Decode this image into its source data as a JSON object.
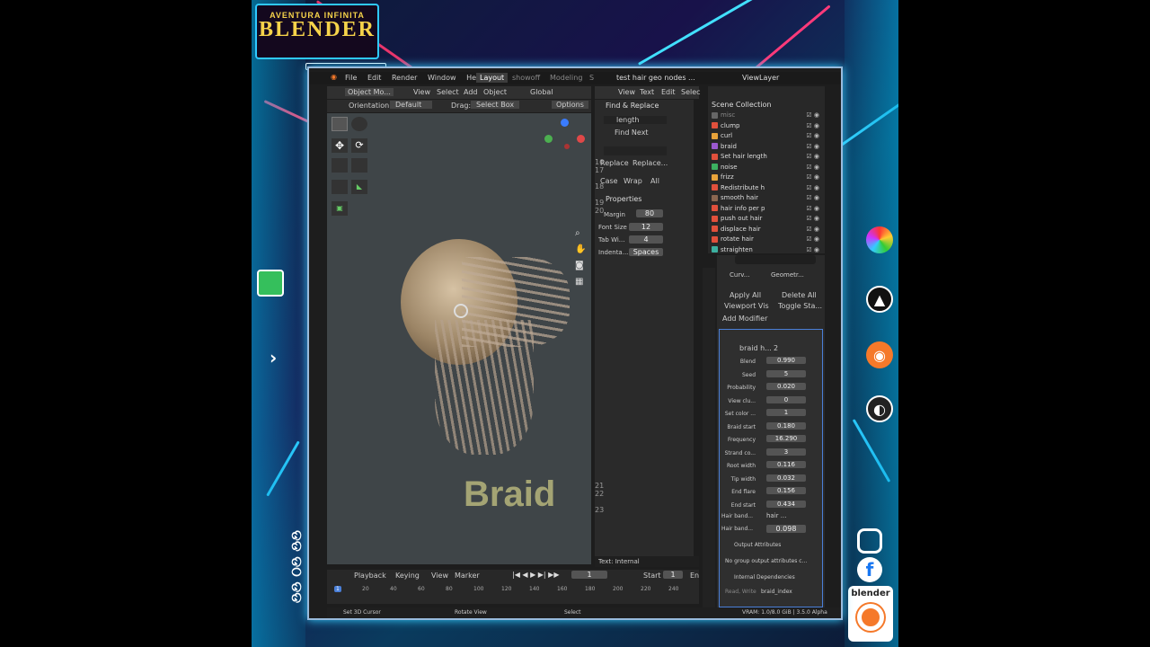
{
  "logo": {
    "line1": "AVENTURA INFINITA",
    "line2": "BLENDER"
  },
  "side_text": "ଡଡ ଡଠ ଡଡ",
  "menu": [
    "File",
    "Edit",
    "Render",
    "Window",
    "Help"
  ],
  "workspaces": [
    "Layout",
    "showoff",
    "Modeling"
  ],
  "workspace_extra": "S",
  "file_title": "test hair geo nodes ...",
  "view_layer": "ViewLayer",
  "viewport_header": {
    "mode": "Object Mo...",
    "menu": [
      "View",
      "Select",
      "Add",
      "Object"
    ],
    "transform": "Global"
  },
  "viewport_sub": {
    "orientation_label": "Orientation:",
    "orientation": "Default",
    "drag_label": "Drag:",
    "drag": "Select Box",
    "options": "Options"
  },
  "viewport_text": "Braid",
  "text_editor_menu": [
    "View",
    "Text",
    "Edit",
    "Selec"
  ],
  "find_replace": {
    "title": "Find & Replace",
    "find_value": "length",
    "find_next": "Find Next",
    "replace": "Replace",
    "replace_all": "Replace...",
    "case": "Case",
    "wrap": "Wrap",
    "all": "All"
  },
  "properties_text": {
    "title": "Properties",
    "margin_label": "Margin",
    "margin": "80",
    "font_label": "Font Size",
    "font": "12",
    "tab_label": "Tab Wi...",
    "tab": "4",
    "indent_label": "Indenta...",
    "indent": "Spaces"
  },
  "line_numbers_top": [
    "16",
    "17",
    "",
    "18",
    "",
    "19",
    "20"
  ],
  "line_numbers_bottom": [
    "21",
    "22",
    "",
    "23"
  ],
  "text_footer": "Text: Internal",
  "outliner": {
    "title": "Scene Collection",
    "items": [
      {
        "name": "misc",
        "color": "#666666"
      },
      {
        "name": "clump",
        "color": "#e0503c"
      },
      {
        "name": "curl",
        "color": "#e8a33a"
      },
      {
        "name": "braid",
        "color": "#9b59d0"
      },
      {
        "name": "Set hair length",
        "color": "#e0503c"
      },
      {
        "name": "noise",
        "color": "#3cb060"
      },
      {
        "name": "frizz",
        "color": "#e8a33a"
      },
      {
        "name": "Redistribute h",
        "color": "#e0503c"
      },
      {
        "name": "smooth hair",
        "color": "#8a6650"
      },
      {
        "name": "hair info per p",
        "color": "#e0503c"
      },
      {
        "name": "push out hair",
        "color": "#e0503c"
      },
      {
        "name": "displace hair",
        "color": "#e0503c"
      },
      {
        "name": "rotate hair",
        "color": "#e0503c"
      },
      {
        "name": "straighten",
        "color": "#3cb0a0"
      }
    ]
  },
  "modifier_panel": {
    "breadcrumb_obj": "Curv...",
    "breadcrumb_mod": "Geometr...",
    "apply_all": "Apply All",
    "delete_all": "Delete All",
    "viewport_vis": "Viewport Vis",
    "toggle_stack": "Toggle Sta...",
    "add_modifier": "Add Modifier",
    "modifier_name": "braid h...",
    "modifier_users": "2",
    "fields": [
      {
        "label": "Blend",
        "value": "0.990"
      },
      {
        "label": "Seed",
        "value": "5"
      },
      {
        "label": "Probability",
        "value": "0.020"
      },
      {
        "label": "View clu...",
        "value": "0"
      },
      {
        "label": "Set color ...",
        "value": "1"
      },
      {
        "label": "Braid start",
        "value": "0.180"
      },
      {
        "label": "Frequency",
        "value": "16.290"
      },
      {
        "label": "Strand co...",
        "value": "3"
      },
      {
        "label": "Root width",
        "value": "0.116"
      },
      {
        "label": "Tip width",
        "value": "0.032"
      },
      {
        "label": "End flare",
        "value": "0.156"
      },
      {
        "label": "End start",
        "value": "0.434"
      }
    ],
    "hair_band_label": "Hair band...",
    "hair_band_value": "hair ...",
    "hair_band2_label": "Hair band...",
    "hair_band2_value": "0.098",
    "output_attributes": "Output Attributes",
    "no_output": "No group output attributes c...",
    "internal_deps": "Internal Dependencies",
    "read_write": "Read, Write",
    "read_write_value": "braid_index"
  },
  "timeline": {
    "menu": [
      "Playback",
      "Keying",
      "View",
      "Marker"
    ],
    "current_frame": "1",
    "start_label": "Start",
    "start": "1",
    "end_label": "En",
    "ticks": [
      "1",
      "20",
      "40",
      "60",
      "80",
      "100",
      "120",
      "140",
      "160",
      "180",
      "200",
      "220",
      "240"
    ]
  },
  "status_bar": {
    "left": "Set 3D Cursor",
    "middle": "Rotate View",
    "right": "Select",
    "vram": "VRAM: 1.0/8.0 GiB | 3.5.0 Alpha"
  },
  "social": {
    "blender_label": "blender"
  }
}
